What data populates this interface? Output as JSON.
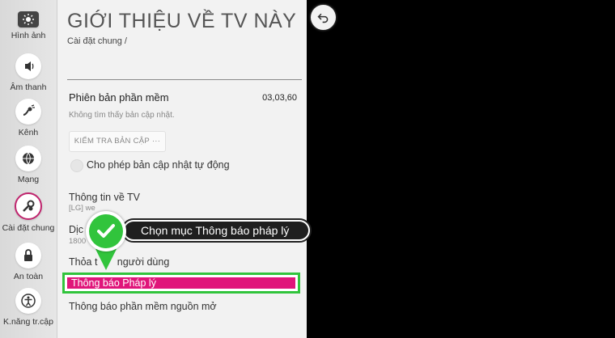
{
  "sidebar": {
    "items": [
      {
        "label": "Hình ảnh",
        "icon": "picture-icon"
      },
      {
        "label": "Âm thanh",
        "icon": "sound-icon"
      },
      {
        "label": "Kênh",
        "icon": "channel-icon"
      },
      {
        "label": "Mạng",
        "icon": "network-icon"
      },
      {
        "label": "Cài đặt chung",
        "icon": "general-settings-icon"
      },
      {
        "label": "An toàn",
        "icon": "lock-icon"
      },
      {
        "label": "K.năng tr.cập",
        "icon": "accessibility-icon"
      }
    ]
  },
  "header": {
    "title": "GIỚI THIỆU VỀ TV NÀY",
    "breadcrumb": "Cài đặt chung /"
  },
  "software": {
    "label": "Phiên bản phần mềm",
    "value": "03,03,60",
    "status": "Không tìm thấy bản cập nhật.",
    "check_button": "KIỂM TRA BẢN CẬP ···"
  },
  "auto_update": {
    "label": "Cho phép bản cập nhật tự động"
  },
  "tv_info": {
    "label": "Thông tin về TV",
    "sub": "[LG] we"
  },
  "service": {
    "label": "Dịc",
    "sub": "1800"
  },
  "terms": {
    "label": "Thỏa t       người dùng"
  },
  "legal": {
    "label": "Thông báo Pháp lý"
  },
  "oss": {
    "label": "Thông báo phần mềm nguồn mở"
  },
  "annotation": {
    "text": "Chọn mục Thông báo pháp lý"
  },
  "colors": {
    "accent": "#e0157a",
    "highlight": "#31c43c"
  }
}
